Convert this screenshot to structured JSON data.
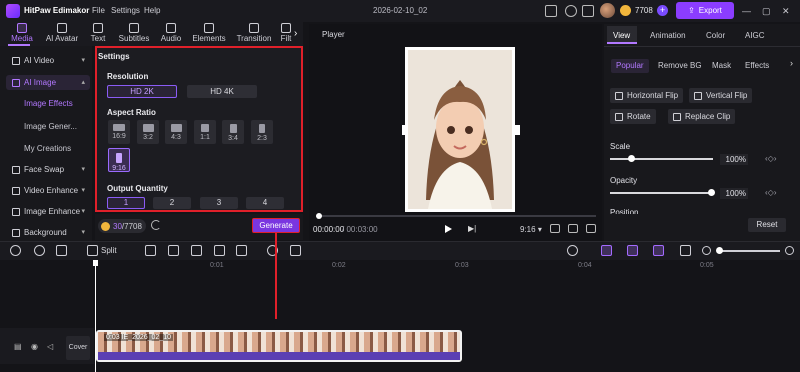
{
  "app": {
    "name": "HitPaw Edimakor",
    "menu": [
      "File",
      "Settings",
      "Help"
    ],
    "project_title": "2026-02-10_02",
    "credits": "7708",
    "export_label": "Export",
    "plus": "+"
  },
  "top_tabs": [
    {
      "label": "Media",
      "active": true
    },
    {
      "label": "AI Avatar"
    },
    {
      "label": "Text"
    },
    {
      "label": "Subtitles"
    },
    {
      "label": "Audio"
    },
    {
      "label": "Elements"
    },
    {
      "label": "Transition"
    },
    {
      "label": "Filt"
    }
  ],
  "sidebar": {
    "items": [
      {
        "label": "AI Video"
      },
      {
        "label": "AI Image",
        "active": true
      },
      {
        "label": "Face Swap"
      },
      {
        "label": "Video Enhance"
      },
      {
        "label": "Image Enhance"
      },
      {
        "label": "Background"
      }
    ],
    "subitems": [
      "Image Effects",
      "Image Gener...",
      "My Creations"
    ]
  },
  "settings": {
    "title": "Settings",
    "resolution_title": "Resolution",
    "resolutions": [
      "HD 2K",
      "HD 4K"
    ],
    "aspect_title": "Aspect Ratio",
    "aspect_ratios": [
      "16:9",
      "3:2",
      "4:3",
      "1:1",
      "3:4",
      "2:3",
      "9:16"
    ],
    "aspect_selected": "9:16",
    "quantity_title": "Output Quantity",
    "quantities": [
      "1",
      "2",
      "3",
      "4"
    ],
    "quantity_selected": "1"
  },
  "generate": {
    "quota_used": "30",
    "quota_total": "/7708",
    "label": "Generate"
  },
  "player": {
    "title": "Player",
    "time_current": "00:00:00",
    "time_total": "/ 00:03:00",
    "ratio": "9:16"
  },
  "right_panel": {
    "tabs": [
      "View",
      "Animation",
      "Color",
      "AIGC"
    ],
    "subtabs": [
      "Popular",
      "Remove BG",
      "Mask",
      "Effects"
    ],
    "buttons": [
      "Horizontal Flip",
      "Vertical Flip",
      "Rotate",
      "Replace Clip"
    ],
    "scale_label": "Scale",
    "scale_value": "100%",
    "opacity_label": "Opacity",
    "opacity_value": "100%",
    "position_label": "Position",
    "reset_label": "Reset"
  },
  "timeline": {
    "split_label": "Split",
    "ticks": [
      "0:01",
      "0:02",
      "0:03",
      "0:04",
      "0:05"
    ],
    "cover_label": "Cover",
    "clip_label": "0:03  IE_2026_02_10"
  },
  "colors": {
    "accent": "#8b3dff",
    "highlight_red": "#e0202a"
  }
}
